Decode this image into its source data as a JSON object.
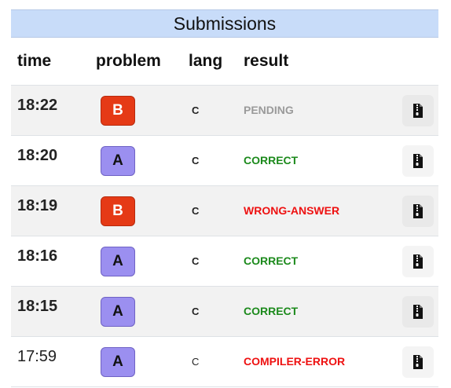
{
  "header": {
    "title": "Submissions"
  },
  "columns": {
    "time": "time",
    "problem": "problem",
    "lang": "lang",
    "result": "result"
  },
  "colors": {
    "badge_red": "#e53a16",
    "badge_purple": "#9b8ff0",
    "pending": "#9a9a9a",
    "correct": "#1c8a1c",
    "error": "#ee1111"
  },
  "rows": [
    {
      "time": "18:22",
      "problem": "B",
      "lang": "C",
      "result": "PENDING"
    },
    {
      "time": "18:20",
      "problem": "A",
      "lang": "C",
      "result": "CORRECT"
    },
    {
      "time": "18:19",
      "problem": "B",
      "lang": "C",
      "result": "WRONG-ANSWER"
    },
    {
      "time": "18:16",
      "problem": "A",
      "lang": "C",
      "result": "CORRECT"
    },
    {
      "time": "18:15",
      "problem": "A",
      "lang": "C",
      "result": "CORRECT"
    },
    {
      "time": "17:59",
      "problem": "A",
      "lang": "C",
      "result": "COMPILER-ERROR"
    }
  ],
  "row_icon": "zip-file-icon"
}
